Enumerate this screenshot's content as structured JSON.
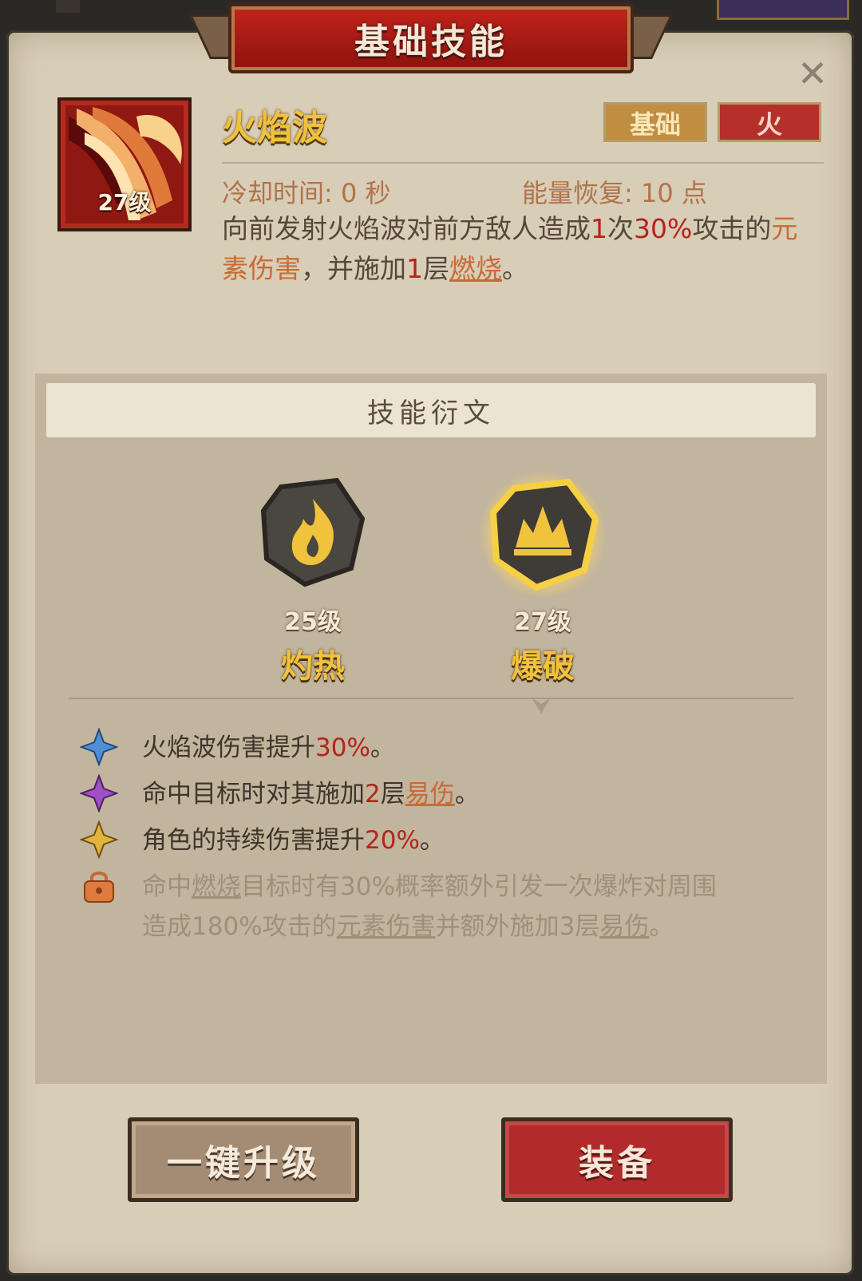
{
  "header": {
    "title": "基础技能",
    "close_icon": "close-icon"
  },
  "skill": {
    "name": "火焰波",
    "icon": "fire-claw-icon",
    "level_badge": "27级",
    "tags": {
      "basic": "基础",
      "element": "火"
    },
    "cooldown_label": "冷却时间: 0 秒",
    "energy_label": "能量恢复: 10 点",
    "desc": {
      "p1": "向前发射火焰波对前方敌人造成",
      "hits": "1",
      "p2": "次",
      "pct": "30%",
      "p3": "攻击的",
      "dmg_type": "元素伤害",
      "p4": "，并施加",
      "stacks": "1",
      "p5": "层",
      "status": "燃烧",
      "p6": "。"
    }
  },
  "runes": {
    "header": "技能衍文",
    "items": [
      {
        "level": "25级",
        "name": "灼热",
        "icon": "flame-rune-icon"
      },
      {
        "level": "27级",
        "name": "爆破",
        "icon": "explosion-rune-icon"
      }
    ]
  },
  "effects": [
    {
      "gem": "blue-diamond-icon",
      "text_a": "火焰波伤害提升",
      "value": "30%",
      "text_b": "。"
    },
    {
      "gem": "purple-diamond-icon",
      "text_a": "命中目标时对其施加",
      "value": "2",
      "text_b": "层",
      "link": "易伤",
      "text_c": "。"
    },
    {
      "gem": "yellow-diamond-icon",
      "text_a": "角色的持续伤害提升",
      "value": "20%",
      "text_b": "。"
    },
    {
      "gem": "lock-icon",
      "locked": true,
      "t1": "命中",
      "l1": "燃烧",
      "t2": "目标时有30%概率额外引发一次爆炸对周围",
      "t3": "造成180%攻击的",
      "l2": "元素伤害",
      "t4": "并额外施加3层",
      "l3": "易伤",
      "t5": "。"
    }
  ],
  "buttons": {
    "upgrade": "一键升级",
    "equip": "装备"
  },
  "colors": {
    "accent_red": "#b5231c",
    "gold": "#f0c23c",
    "panel": "#d8cdb6"
  }
}
